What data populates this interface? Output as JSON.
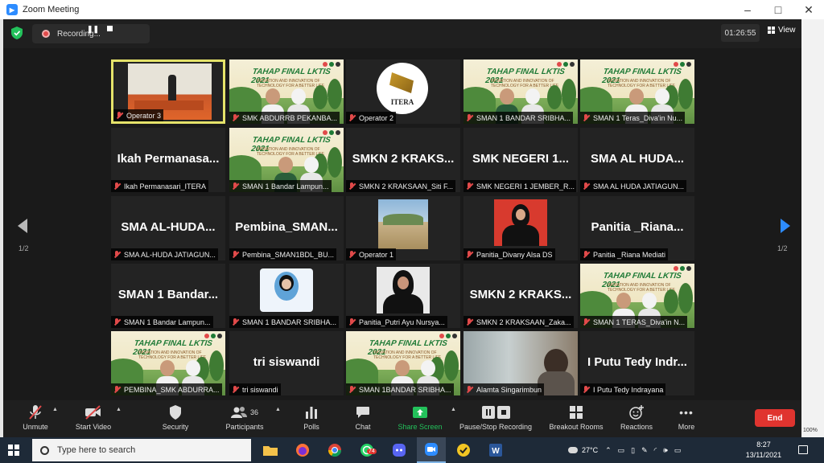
{
  "window": {
    "title": "Zoom Meeting"
  },
  "topbar": {
    "recording_label": "Recording...",
    "timer": "01:26:55",
    "view_label": "View"
  },
  "pager": {
    "left": "1/2",
    "right": "1/2"
  },
  "tiles": [
    {
      "label": "Operator 3",
      "type": "stage"
    },
    {
      "label": "SMK ABDURRB PEKANBA...",
      "type": "poster"
    },
    {
      "label": "Operator 2",
      "type": "itera",
      "logo_text": "ITERA"
    },
    {
      "label": "SMAN 1 BANDAR SRIBHA...",
      "type": "poster"
    },
    {
      "label": "SMAN 1 Teras_Diva'in Nu...",
      "type": "poster"
    },
    {
      "label": "Ikah Permanasari_ITERA",
      "type": "name",
      "big": "Ikah  Permanasa..."
    },
    {
      "label": "SMAN 1 Bandar Lampun...",
      "type": "poster"
    },
    {
      "label": "SMKN 2 KRAKSAAN_Siti F...",
      "type": "name",
      "big": "SMKN 2 KRAKS..."
    },
    {
      "label": "SMK NEGERI 1 JEMBER_R...",
      "type": "name",
      "big": "SMK NEGERI 1..."
    },
    {
      "label": "SMA AL HUDA JATIAGUN...",
      "type": "name",
      "big": "SMA AL HUDA..."
    },
    {
      "label": "SMA AL-HUDA JATIAGUN...",
      "type": "name",
      "big": "SMA AL-HUDA..."
    },
    {
      "label": "Pembina_SMAN1BDL_BU...",
      "type": "name",
      "big": "Pembina_SMAN..."
    },
    {
      "label": "Operator 1",
      "type": "outdoor"
    },
    {
      "label": "Panitia_Divany Alsa DS",
      "type": "portrait"
    },
    {
      "label": "Panitia _Riana Mediati",
      "type": "name",
      "big": "Panitia _Riana..."
    },
    {
      "label": "SMAN 1 Bandar Lampun...",
      "type": "name",
      "big": "SMAN 1 Bandar..."
    },
    {
      "label": "SMAN 1 BANDAR SRIBHA...",
      "type": "card"
    },
    {
      "label": "Panitia_Putri Ayu Nursya...",
      "type": "portrait2"
    },
    {
      "label": "SMKN 2 KRAKSAAN_Zaka...",
      "type": "name",
      "big": "SMKN 2 KRAKS..."
    },
    {
      "label": "SMAN 1 TERAS_Diva'in N...",
      "type": "poster"
    },
    {
      "label": "PEMBINA_SMK ABDURRA...",
      "type": "poster"
    },
    {
      "label": "tri siswandi",
      "type": "name",
      "big": "tri siswandi"
    },
    {
      "label": "SMAN 1BANDAR SRIBHA...",
      "type": "poster"
    },
    {
      "label": "Alamta Singarimbun",
      "type": "room"
    },
    {
      "label": "I Putu Tedy Indrayana",
      "type": "name",
      "big": "I Putu Tedy Indr..."
    }
  ],
  "poster": {
    "title": "TAHAP FINAL LKTIS 2021",
    "subtitle": "INOVATION AND INNOVATION OF TECHNOLOGY FOR A BETTER LIFE"
  },
  "toolbar": {
    "unmute": "Unmute",
    "start_video": "Start Video",
    "security": "Security",
    "participants": "Participants",
    "participants_count": "36",
    "polls": "Polls",
    "chat": "Chat",
    "share_screen": "Share Screen",
    "pause_stop_recording": "Pause/Stop Recording",
    "breakout_rooms": "Breakout Rooms",
    "reactions": "Reactions",
    "more": "More",
    "end": "End"
  },
  "side": {
    "zoom_pct": "100%"
  },
  "taskbar": {
    "search_placeholder": "Type here to search",
    "whatsapp_badge": "74",
    "temperature": "27°C",
    "time": "8:27",
    "date": "13/11/2021"
  },
  "colors": {
    "accent": "#2d8cff",
    "end": "#e0342f",
    "active_speaker": "#e5e36a",
    "muted": "#e14a4a"
  }
}
